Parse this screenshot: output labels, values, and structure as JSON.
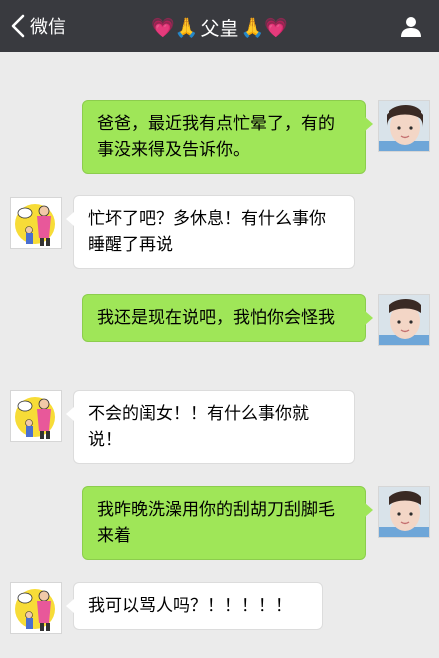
{
  "header": {
    "back_label": "微信",
    "title_prefix": "💗🙏",
    "title_name": "父皇",
    "title_suffix": "🙏💗"
  },
  "messages": [
    {
      "side": "right",
      "text": "爸爸，最近我有点忙晕了，有的事没来得及告诉你。"
    },
    {
      "side": "left",
      "text": "忙坏了吧？多休息！有什么事你睡醒了再说"
    },
    {
      "side": "right",
      "text": "我还是现在说吧，我怕你会怪我"
    },
    {
      "side": "left",
      "text": "不会的闺女！！有什么事你就说！"
    },
    {
      "side": "right",
      "text": "我昨晚洗澡用你的刮胡刀刮脚毛来着"
    },
    {
      "side": "left",
      "text": "我可以骂人吗？！！！！！"
    }
  ],
  "colors": {
    "topbar": "#393a3f",
    "background": "#ebebeb",
    "sent_bubble": "#9fe658",
    "received_bubble": "#ffffff"
  }
}
